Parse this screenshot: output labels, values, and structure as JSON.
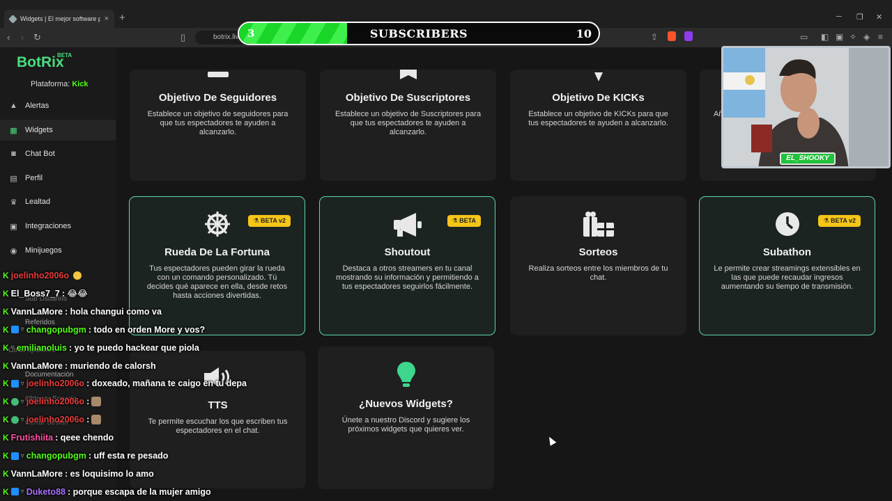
{
  "browser": {
    "tab_title": "Widgets | El mejor software para",
    "url": "botrix.live"
  },
  "overlay": {
    "current": "3",
    "label": "SUBSCRIBERS",
    "goal": "10",
    "progress_fraction": 0.3
  },
  "sidebar": {
    "logo": "BotRix",
    "logo_badge": "BETA",
    "platform_label": "Plataforma:",
    "platform_value": "Kick",
    "items": [
      {
        "label": "Alertas",
        "icon": "warning-icon"
      },
      {
        "label": "Widgets",
        "icon": "grid-icon",
        "active": true
      },
      {
        "label": "Chat Bot",
        "icon": "robot-icon"
      },
      {
        "label": "Perfil",
        "icon": "id-card-icon"
      },
      {
        "label": "Lealtad",
        "icon": "trophy-icon"
      },
      {
        "label": "Integraciones",
        "icon": "layers-icon"
      },
      {
        "label": "Minijuegos",
        "icon": "gamepad-icon"
      }
    ],
    "faded": [
      "Sub Usuarios",
      "Referidos",
      "Otras opciones",
      "Documentación",
      "Obtener Soporte",
      "Cerrar Sesión"
    ]
  },
  "cards": {
    "seguidores": {
      "title": "Objetivo De Seguidores",
      "desc": "Establece un objetivo de seguidores para que tus espectadores te ayuden a alcanzarlo."
    },
    "suscriptores": {
      "title": "Objetivo De Suscriptores",
      "desc": "Establece un objetivo de Suscriptores para que tus espectadores te ayuden a alcanzarlo."
    },
    "kicks": {
      "title": "Objetivo De KICKs",
      "desc": "Establece un objetivo de KICKs para que tus espectadores te ayuden a alcanzarlo."
    },
    "partial": {
      "desc": "Añ"
    },
    "rueda": {
      "title": "Rueda De La Fortuna",
      "badge": "BETA v2",
      "desc": "Tus espectadores pueden girar la rueda con un comando personalizado. Tú decides qué aparece en ella, desde retos hasta acciones divertidas."
    },
    "shoutout": {
      "title": "Shoutout",
      "badge": "BETA",
      "desc": "Destaca a otros streamers en tu canal mostrando su información y permitiendo a tus espectadores seguirlos fácilmente."
    },
    "sorteos": {
      "title": "Sorteos",
      "desc": "Realiza sorteos entre los miembros de tu chat."
    },
    "subathon": {
      "title": "Subathon",
      "badge": "BETA v2",
      "desc": "Le permite crear streamings extensibles en las que puede recaudar ingresos aumentando su tiempo de transmisión."
    },
    "tts": {
      "title": "TTS",
      "desc": "Te permite escuchar los que escriben tus espectadores en el chat."
    },
    "nuevos": {
      "title": "¿Nuevos Widgets?",
      "desc": "Únete a nuestro Discord y sugiere los próximos widgets que quieres ver."
    }
  },
  "webcam": {
    "name": "EL_SHOOKY"
  },
  "chat": [
    {
      "user": "joelinho2006o",
      "color": "#e83a3a",
      "msg": "",
      "badges": [
        "k"
      ],
      "emote": "ghost"
    },
    {
      "user": "El_Boss7_7",
      "color": "#ffffff",
      "msg": ": 😂😂",
      "badges": [
        "k"
      ]
    },
    {
      "user": "VannLaMore",
      "color": "#ffffff",
      "msg": ": hola changui como va",
      "badges": [
        "k"
      ]
    },
    {
      "user": "changopubgm",
      "color": "#53fc18",
      "msg": ": todo en orden More y vos?",
      "badges": [
        "k",
        "b",
        "s"
      ]
    },
    {
      "user": "emilianoluis",
      "color": "#53fc18",
      "msg": ": yo te puedo hackear que piola",
      "badges": [
        "k",
        "s"
      ]
    },
    {
      "user": "VannLaMore",
      "color": "#ffffff",
      "msg": ": muriendo de calorsh",
      "badges": [
        "k"
      ]
    },
    {
      "user": "joelinho2006o",
      "color": "#e83a3a",
      "msg": ": doxeado, mañana te caigo en tu depa",
      "badges": [
        "k",
        "b",
        "s"
      ]
    },
    {
      "user": "joelinho2006o",
      "color": "#e83a3a",
      "msg": ":",
      "badges": [
        "k",
        "b2",
        "s"
      ],
      "emote": "hand"
    },
    {
      "user": "joelinho2006o",
      "color": "#e83a3a",
      "msg": ":",
      "badges": [
        "k",
        "b2",
        "s"
      ],
      "emote": "cat"
    },
    {
      "user": "Frutishiita",
      "color": "#ff4fa3",
      "msg": ": qeee chendo",
      "badges": [
        "k"
      ]
    },
    {
      "user": "changopubgm",
      "color": "#53fc18",
      "msg": ": uff esta re pesado",
      "badges": [
        "k",
        "b",
        "s"
      ]
    },
    {
      "user": "VannLaMore",
      "color": "#ffffff",
      "msg": ": es loquisimo lo amo",
      "badges": [
        "k"
      ]
    },
    {
      "user": "Duketo88",
      "color": "#a970ff",
      "msg": ": porque escapa de la mujer amigo",
      "badges": [
        "k",
        "b",
        "s"
      ]
    }
  ]
}
